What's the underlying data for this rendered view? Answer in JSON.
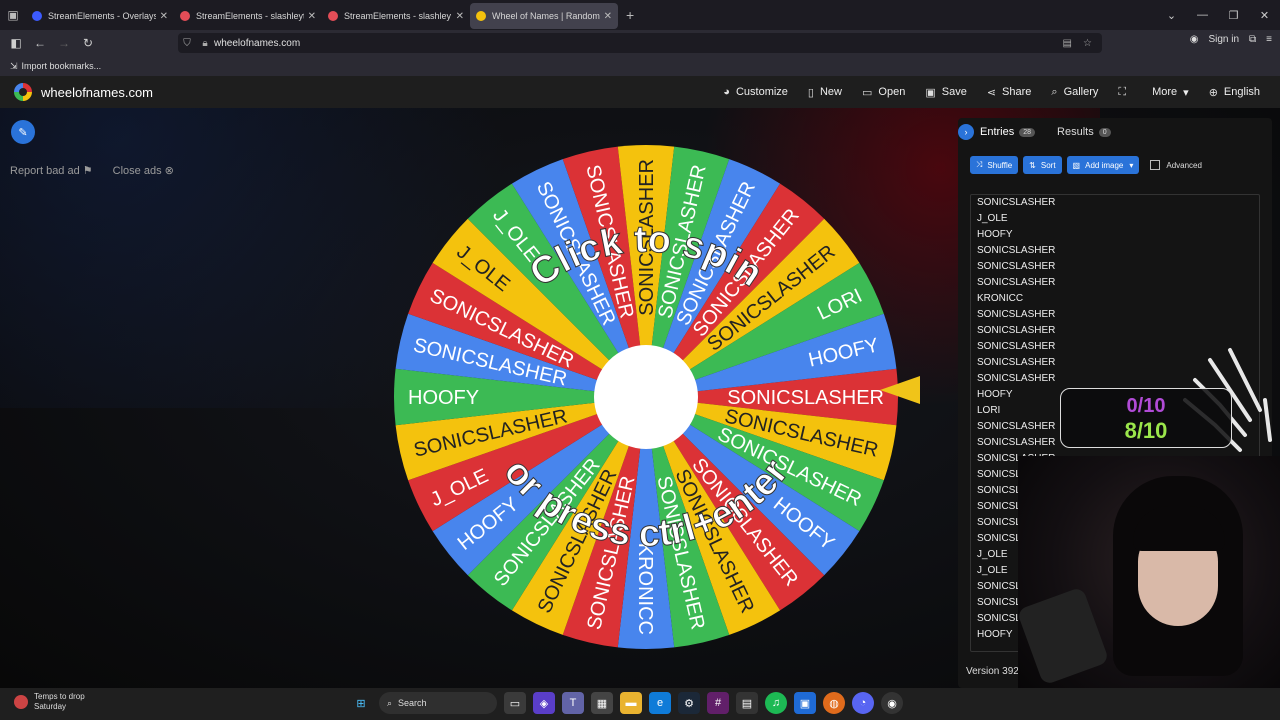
{
  "browser": {
    "tabs": [
      {
        "label": "StreamElements - Overlays",
        "icon": "streamelements-icon",
        "color": "#3c5bff",
        "active": false
      },
      {
        "label": "StreamElements - slashleytv",
        "icon": "streamelements-icon",
        "color": "#e34d57",
        "active": false
      },
      {
        "label": "StreamElements - slashley",
        "icon": "streamelements-icon",
        "color": "#e34d57",
        "active": false
      },
      {
        "label": "Wheel of Names | Random nam",
        "icon": "wheel-icon",
        "color": "#f4c20d",
        "active": true
      }
    ],
    "url": "wheelofnames.com",
    "sign_in": "Sign in",
    "bookmark_label": "Import bookmarks..."
  },
  "site": {
    "logo": "wheelofnames.com",
    "menu": [
      {
        "label": "Customize",
        "icon": "palette-icon"
      },
      {
        "label": "New",
        "icon": "file-icon"
      },
      {
        "label": "Open",
        "icon": "folder-icon"
      },
      {
        "label": "Save",
        "icon": "save-icon"
      },
      {
        "label": "Share",
        "icon": "share-icon"
      },
      {
        "label": "Gallery",
        "icon": "search-icon"
      },
      {
        "label": "",
        "icon": "fullscreen-icon"
      },
      {
        "label": "More",
        "icon": "chevron-down-icon"
      },
      {
        "label": "English",
        "icon": "globe-icon"
      }
    ],
    "report_ad": "Report bad ad",
    "close_ads": "Close ads"
  },
  "wheel": {
    "center_text_top": "Click to spin",
    "center_text_bottom": "or press ctrl+enter",
    "colors": [
      "#db3236",
      "#f4c20d",
      "#3cba54",
      "#4885ed"
    ],
    "segments": [
      "SONICSLASHER",
      "SONICSLASHER",
      "SONICSLASHER",
      "HOOFY",
      "SONICSLASHER",
      "SONICSLASHER",
      "SONICSLASHER",
      "KRONICC",
      "SONICSLASHER",
      "SONICSLASHER",
      "SONICSLASHER",
      "HOOFY",
      "J_OLE",
      "SONICSLASHER",
      "HOOFY",
      "SONICSLASHER",
      "SONICSLASHER",
      "J_OLE",
      "J_OLE",
      "SONICSLASHER",
      "SONICSLASHER",
      "SONICSLASHER",
      "SONICSLASHER",
      "SONICSLASHER",
      "SONICSLASHER",
      "SONICSLASHER",
      "LORI",
      "HOOFY"
    ]
  },
  "panel": {
    "entries_tab": "Entries",
    "entries_count": "28",
    "results_tab": "Results",
    "results_count": "0",
    "shuffle": "Shuffle",
    "sort": "Sort",
    "add_image": "Add image",
    "advanced": "Advanced",
    "entries": [
      "SONICSLASHER",
      "J_OLE",
      "HOOFY",
      "SONICSLASHER",
      "SONICSLASHER",
      "SONICSLASHER",
      "KRONICC",
      "SONICSLASHER",
      "SONICSLASHER",
      "SONICSLASHER",
      "SONICSLASHER",
      "SONICSLASHER",
      "HOOFY",
      "LORI",
      "SONICSLASHER",
      "SONICSLASHER",
      "SONICSLASHER",
      "SONICSLASHER",
      "SONICSLASHER",
      "SONICSLASHER",
      "SONICSLASHER",
      "SONICSLASHER",
      "J_OLE",
      "J_OLE",
      "SONICSLASHER",
      "SONICSLASHER",
      "SONICSLASHER",
      "HOOFY"
    ],
    "version": "Version 392"
  },
  "overlay": {
    "counter_top": "0/10",
    "counter_bottom": "8/10"
  },
  "taskbar": {
    "weather_line1": "Temps to drop",
    "weather_line2": "Saturday",
    "search": "Search"
  }
}
